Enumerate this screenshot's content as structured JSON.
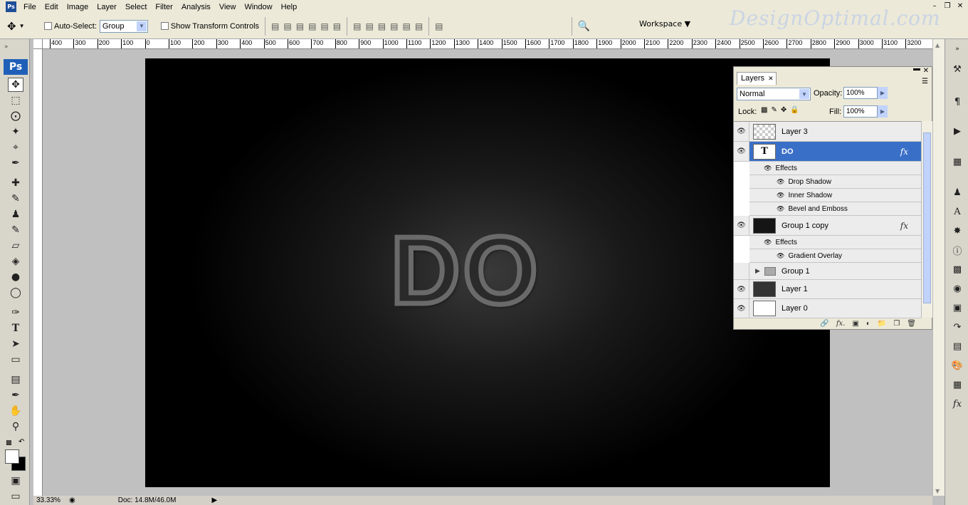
{
  "menu": [
    "File",
    "Edit",
    "Image",
    "Layer",
    "Select",
    "Filter",
    "Analysis",
    "View",
    "Window",
    "Help"
  ],
  "options": {
    "auto_select_label": "Auto-Select:",
    "auto_select_value": "Group",
    "show_transform_label": "Show Transform Controls",
    "workspace_label": "Workspace"
  },
  "watermark": "DesignOptimal.com",
  "ruler_ticks": [
    "400",
    "300",
    "200",
    "100",
    "0",
    "100",
    "200",
    "300",
    "400",
    "500",
    "600",
    "700",
    "800",
    "900",
    "1000",
    "1100",
    "1200",
    "1300",
    "1400",
    "1500",
    "1600",
    "1700",
    "1800",
    "1900",
    "2000",
    "2100",
    "2200",
    "2300",
    "2400",
    "2500",
    "2600",
    "2700",
    "2800",
    "2900",
    "3000",
    "3100",
    "3200"
  ],
  "toolbox": {
    "logo": "Ps"
  },
  "document_text": "DO",
  "status": {
    "zoom": "33.33%",
    "doc": "Doc: 14.8M/46.0M"
  },
  "layers_panel": {
    "tab_label": "Layers",
    "blend_mode": "Normal",
    "opacity_label": "Opacity:",
    "opacity_value": "100%",
    "lock_label": "Lock:",
    "fill_label": "Fill:",
    "fill_value": "100%",
    "layers": [
      {
        "name": "Layer 3"
      },
      {
        "name": "DO"
      },
      {
        "name": "Group 1 copy"
      },
      {
        "name": "Group 1"
      },
      {
        "name": "Layer 1"
      },
      {
        "name": "Layer 0"
      }
    ],
    "effects_label": "Effects",
    "do_effects": [
      "Drop Shadow",
      "Inner Shadow",
      "Bevel and Emboss"
    ],
    "group_copy_effects": [
      "Gradient Overlay"
    ],
    "fx_label": "fx"
  }
}
